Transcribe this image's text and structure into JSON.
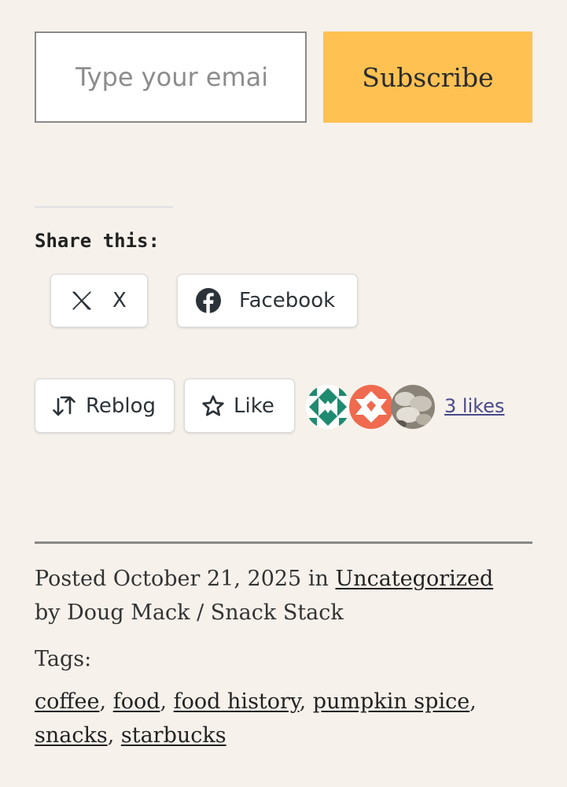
{
  "subscribe": {
    "email_placeholder": "Type your email",
    "button_label": "Subscribe"
  },
  "share": {
    "heading": "Share this:",
    "buttons": [
      {
        "label": "X",
        "icon": "x-logo-icon"
      },
      {
        "label": "Facebook",
        "icon": "facebook-icon"
      }
    ]
  },
  "actions": {
    "reblog_label": "Reblog",
    "like_label": "Like",
    "likes_text": "3 likes"
  },
  "post_meta": {
    "posted_prefix": "Posted",
    "date": "October 21, 2025",
    "in_text": "in",
    "category": "Uncategorized",
    "by_prefix": "by",
    "author": "Doug Mack / Snack Stack"
  },
  "tags": {
    "label": "Tags:",
    "items": [
      "coffee",
      "food",
      "food history",
      "pumpkin spice",
      "snacks",
      "starbucks"
    ]
  },
  "colors": {
    "background": "#f6f1eb",
    "subscribe_button": "#fec152",
    "likes_link": "#4a4a8a"
  }
}
